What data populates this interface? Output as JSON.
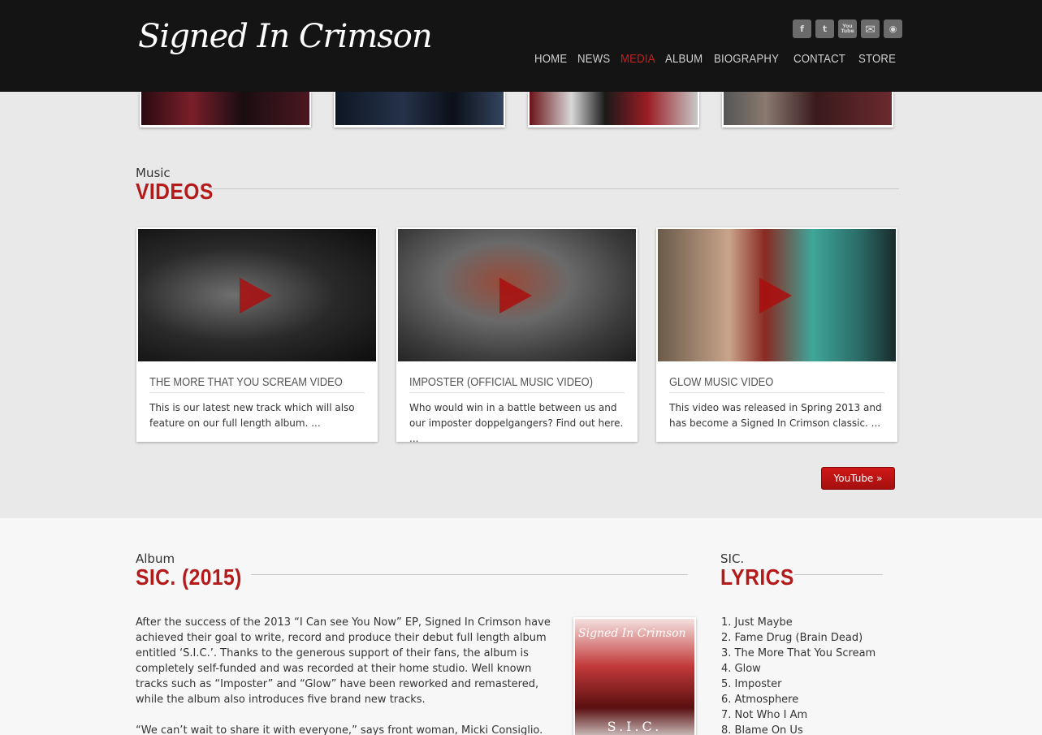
{
  "header": {
    "logo_text": "Signed In Crimson",
    "social": [
      {
        "icon": "facebook-icon",
        "glyph": "f"
      },
      {
        "icon": "twitter-icon",
        "glyph": "t"
      },
      {
        "icon": "youtube-icon",
        "glyph": "You Tube"
      },
      {
        "icon": "email-icon",
        "glyph": "✉"
      },
      {
        "icon": "rss-icon",
        "glyph": "◉"
      }
    ],
    "nav": [
      {
        "label": "HOME",
        "active": false
      },
      {
        "label": "NEWS",
        "active": false
      },
      {
        "label": "MEDIA",
        "active": true
      },
      {
        "label": "ALBUM",
        "active": false
      },
      {
        "label": "BIOGRAPHY",
        "active": false
      },
      {
        "label": "CONTACT",
        "active": false
      },
      {
        "label": "STORE",
        "active": false
      }
    ]
  },
  "videos": {
    "small": "Music",
    "big": "VIDEOS",
    "cards": [
      {
        "title": "THE MORE THAT YOU SCREAM VIDEO",
        "desc": "This is our latest new track which will also feature on our full length album. ..."
      },
      {
        "title": "IMPOSTER (OFFICIAL MUSIC VIDEO)",
        "desc": "Who would win in a battle between us and our imposter doppelgangers? Find out here. ..."
      },
      {
        "title": "GLOW MUSIC VIDEO",
        "desc": "This video was released in Spring 2013 and has become a Signed In Crimson classic. ..."
      }
    ],
    "youtube_button": "YouTube »"
  },
  "album": {
    "small": "Album",
    "big": "SIC. (2015)",
    "paragraphs": [
      "After the success of the 2013 “I Can see You Now” EP, Signed In Crimson have achieved their goal to write, record and produce their debut full length album entitled ‘S.I.C.’. Thanks to the generous support of their fans, the album is completely self-funded and was recorded at their home studio. Well known tracks such as “Imposter” and “Glow” have been reworked and remastered, while the album also introduces five brand new tracks.",
      "“We can’t wait to share it with everyone,” says front woman, Micki Consiglio. “Not"
    ],
    "cover_logo": "Signed In Crimson",
    "cover_title": "S.I.C."
  },
  "lyrics": {
    "small": "SIC.",
    "big": "LYRICS",
    "tracks": [
      "1. Just Maybe",
      "2. Fame Drug (Brain Dead)",
      "3. The More That You Scream",
      "4. Glow",
      "5. Imposter",
      "6. Atmosphere",
      "7. Not Who I Am",
      "8. Blame On Us"
    ]
  }
}
